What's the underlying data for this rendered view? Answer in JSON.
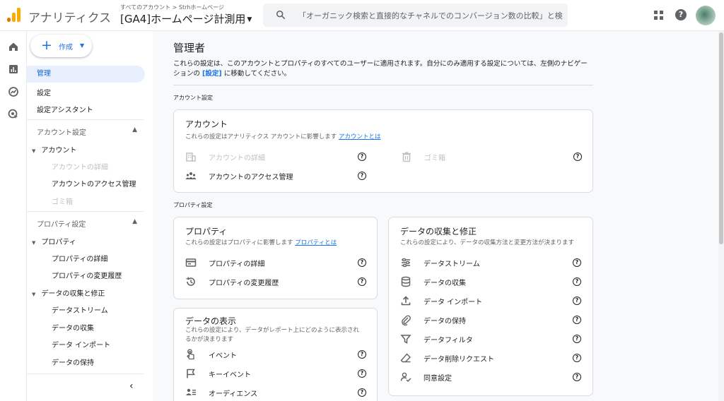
{
  "topbar": {
    "app_title": "アナリティクス",
    "breadcrumb": "すべてのアカウント > Strhホームページ",
    "property_name": "[GA4]ホームページ計測用",
    "search_placeholder": "「オーガニック検索と直接的なチャネルでのコンバージョン数の比較」と検..."
  },
  "nav": {
    "create_label": "作成",
    "admin": "管理",
    "settings": "設定",
    "setup_assistant": "設定アシスタント",
    "account_settings": "アカウント設定",
    "account": "アカウント",
    "account_details": "アカウントの詳細",
    "account_access": "アカウントのアクセス管理",
    "trash": "ゴミ箱",
    "property_settings": "プロパティ設定",
    "property": "プロパティ",
    "property_details": "プロパティの詳細",
    "property_history": "プロパティの変更履歴",
    "data_collection_mod": "データの収集と修正",
    "data_streams": "データストリーム",
    "data_collection": "データの収集",
    "data_import": "データ インポート",
    "data_retention": "データの保持"
  },
  "main": {
    "title": "管理者",
    "intro_prefix": "これらの設定は、このアカウントとプロパティのすべてのユーザーに適用されます。自分にのみ適用する設定については、左側のナビゲーションの ",
    "intro_link": "[設定]",
    "intro_suffix": " に移動してください。",
    "account_section_label": "アカウント設定",
    "property_section_label": "プロパティ設定"
  },
  "account_card": {
    "title": "アカウント",
    "subtitle": "これらの設定はアナリティクス アカウントに影響します",
    "link": "アカウントとは",
    "details": "アカウントの詳細",
    "trash": "ゴミ箱",
    "access": "アカウントのアクセス管理"
  },
  "property_card": {
    "title": "プロパティ",
    "subtitle": "これらの設定はプロパティに影響します",
    "link": "プロパティとは",
    "details": "プロパティの詳細",
    "history": "プロパティの変更履歴"
  },
  "display_card": {
    "title": "データの表示",
    "subtitle_1": "これらの設定により、データがレポート上にどのように表示され",
    "subtitle_2": "るかが決まります",
    "events": "イベント",
    "key_events": "キーイベント",
    "audiences": "オーディエンス"
  },
  "collection_card": {
    "title": "データの収集と修正",
    "subtitle": "これらの設定により、データの収集方法と変更方法が決まります",
    "streams": "データストリーム",
    "collection": "データの収集",
    "import": "データ インポート",
    "retention": "データの保持",
    "filters": "データフィルタ",
    "deletion": "データ削除リクエスト",
    "consent": "同意設定"
  },
  "colors": {
    "accent": "#1a73e8",
    "logo_orange": "#f9ab00",
    "logo_dark_orange": "#e37400",
    "icon_grey": "#5f6368"
  }
}
